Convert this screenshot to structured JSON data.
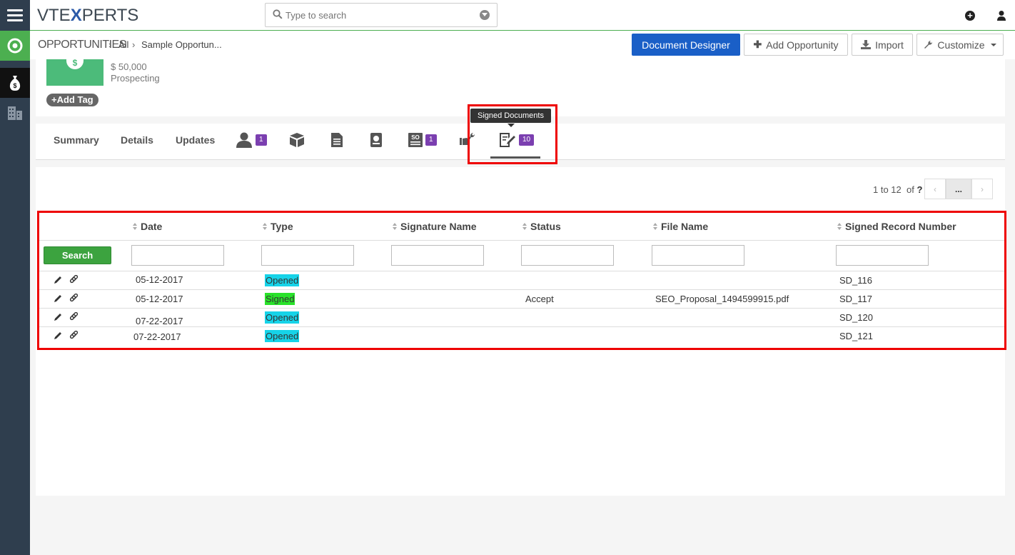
{
  "app": {
    "logo_prefix": "VTE",
    "logo_x": "X",
    "logo_suffix": "PERTS",
    "search_placeholder": "Type to search"
  },
  "header": {
    "module": "OPPORTUNITIES",
    "crumbs": [
      "All",
      "Sample Opportun..."
    ],
    "buttons": {
      "document_designer": "Document Designer",
      "add_opportunity": "Add Opportunity",
      "import": "Import",
      "customize": "Customize"
    }
  },
  "record": {
    "amount": "$ 50,000",
    "stage": "Prospecting",
    "add_tag": "Add Tag"
  },
  "tabs": {
    "summary": "Summary",
    "details": "Details",
    "updates": "Updates",
    "contacts_badge": "1",
    "so_badge": "1",
    "signed_badge": "10",
    "tooltip": "Signed Documents"
  },
  "pager": {
    "range": "1 to 12",
    "of": "of",
    "total": "?",
    "dots": "..."
  },
  "table": {
    "search_label": "Search",
    "columns": [
      "Date",
      "Type",
      "Signature Name",
      "Status",
      "File Name",
      "Signed Record Number"
    ],
    "rows": [
      {
        "date": "05-12-2017",
        "type": "Opened",
        "signature": "",
        "status": "",
        "file": "",
        "record": "SD_116"
      },
      {
        "date": "05-12-2017",
        "type": "Signed",
        "signature": "",
        "status": "Accept",
        "file": "SEO_Proposal_1494599915.pdf",
        "record": "SD_117"
      },
      {
        "date": "07-22-2017",
        "type": "Opened",
        "signature": "",
        "status": "",
        "file": "",
        "record": "SD_120"
      },
      {
        "date": "07-22-2017",
        "type": "Opened",
        "signature": "",
        "status": "",
        "file": "",
        "record": "SD_121"
      }
    ]
  },
  "colors": {
    "primary": "#1a5fc7",
    "green": "#4caf50",
    "opened": "#16d3e8",
    "signed": "#29e22a",
    "badge": "#7b3fb0",
    "highlight": "#e00000"
  }
}
